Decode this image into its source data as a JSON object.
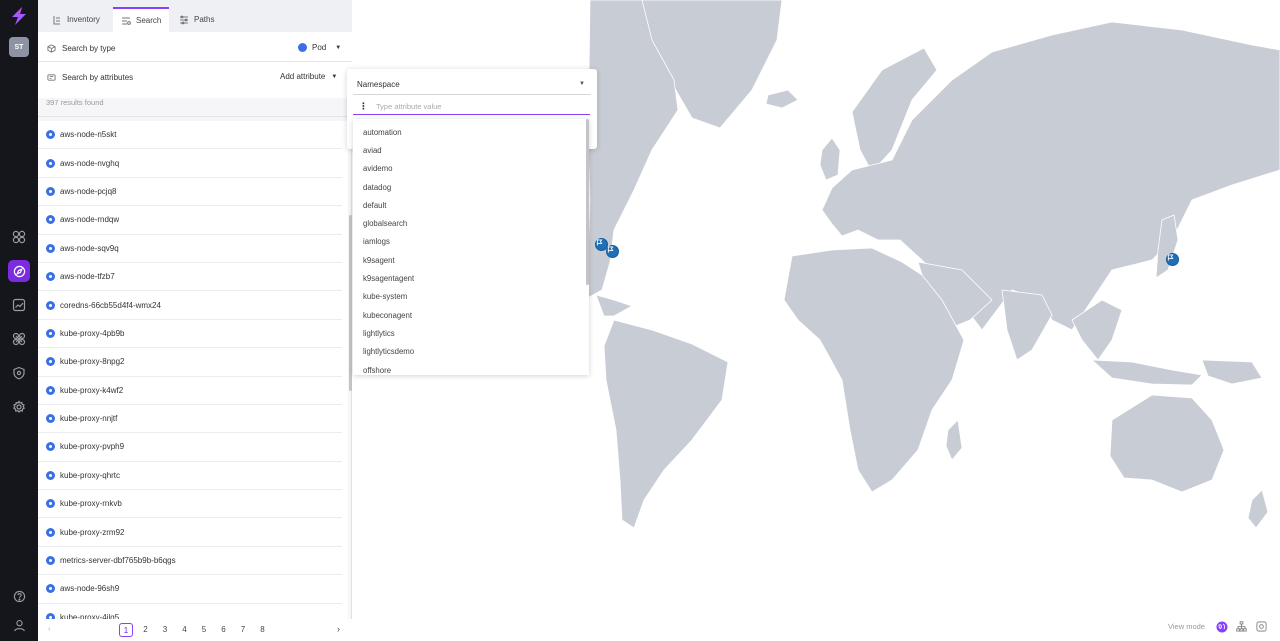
{
  "rail": {
    "avatar_initials": "ST",
    "nav_icons": [
      "dashboard-icon",
      "explore-icon",
      "analytics-icon",
      "integrations-icon",
      "security-icon",
      "settings-icon"
    ],
    "bottom_icons": [
      "help-icon",
      "user-icon"
    ],
    "accent": "#7b2ce0"
  },
  "tabs": [
    {
      "label": "Inventory",
      "icon": "inventory-icon"
    },
    {
      "label": "Search",
      "icon": "search-list-icon"
    },
    {
      "label": "Paths",
      "icon": "paths-icon"
    }
  ],
  "search": {
    "by_type_label": "Search by type",
    "type_value": "Pod",
    "by_attributes_label": "Search by attributes",
    "add_attribute_label": "Add attribute",
    "results_text": "397 results found"
  },
  "results": [
    "aws-node-n5skt",
    "aws-node-nvghq",
    "aws-node-pcjq8",
    "aws-node-rndqw",
    "aws-node-sqv9q",
    "aws-node-tfzb7",
    "coredns-66cb55d4f4-wmx24",
    "kube-proxy-4pb9b",
    "kube-proxy-8npg2",
    "kube-proxy-k4wf2",
    "kube-proxy-nnjtf",
    "kube-proxy-pvph9",
    "kube-proxy-qhrtc",
    "kube-proxy-rnkvb",
    "kube-proxy-zrm92",
    "metrics-server-dbf765b9b-b6qgs",
    "aws-node-96sh9",
    "kube-proxy-4jlg5"
  ],
  "pagination": {
    "pages": [
      "1",
      "2",
      "3",
      "4",
      "5",
      "6",
      "7",
      "8"
    ],
    "current": "1"
  },
  "attribute_popup": {
    "attribute": "Namespace",
    "input_placeholder": "Type attribute value",
    "options": [
      "automation",
      "aviad",
      "avidemo",
      "datadog",
      "default",
      "globalsearch",
      "iamlogs",
      "k9sagent",
      "k9sagentagent",
      "kube-system",
      "kubeconagent",
      "lightlytics",
      "lightlyticsdemo",
      "offshore"
    ]
  },
  "view_mode": {
    "label": "View mode",
    "modes": [
      "globe-icon",
      "topology-icon",
      "layout-icon"
    ],
    "active": "globe-icon"
  },
  "colors": {
    "land": "#c8ccd4",
    "marker": "#1f6fb6",
    "pod_dot": "#3970e4"
  }
}
